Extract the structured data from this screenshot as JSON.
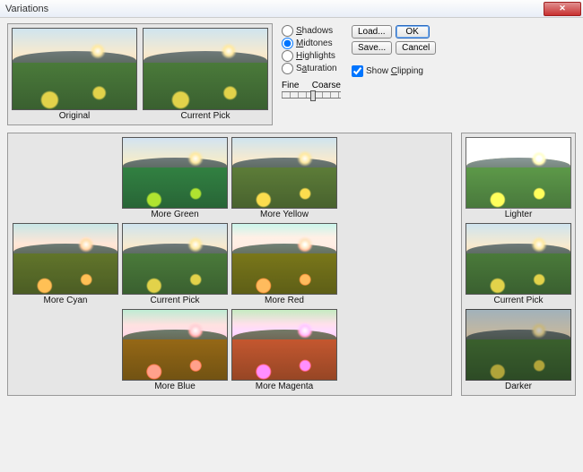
{
  "window": {
    "title": "Variations"
  },
  "top": {
    "original_label": "Original",
    "current_label": "Current Pick"
  },
  "options": {
    "shadows": "Shadows",
    "midtones": "Midtones",
    "highlights": "Highlights",
    "saturation": "Saturation",
    "selected": "midtones",
    "fine": "Fine",
    "coarse": "Coarse",
    "show_clipping": "Show Clipping",
    "show_clipping_checked": true
  },
  "buttons": {
    "load": "Load...",
    "save": "Save...",
    "ok": "OK",
    "cancel": "Cancel"
  },
  "colors": {
    "more_green": "More Green",
    "more_yellow": "More Yellow",
    "more_cyan": "More Cyan",
    "current_pick": "Current Pick",
    "more_red": "More Red",
    "more_blue": "More Blue",
    "more_magenta": "More Magenta"
  },
  "brightness": {
    "lighter": "Lighter",
    "current_pick": "Current Pick",
    "darker": "Darker"
  }
}
